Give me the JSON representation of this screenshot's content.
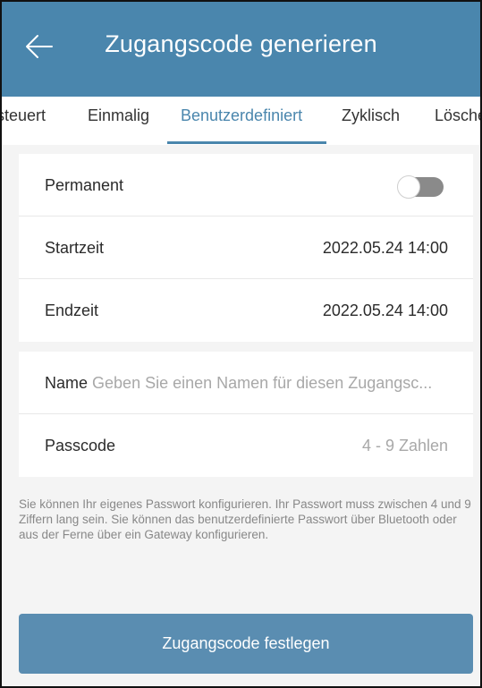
{
  "header": {
    "title": "Zugangscode generieren",
    "back_icon": "arrow-left-icon"
  },
  "tabs": [
    {
      "label": "steuert",
      "active": false
    },
    {
      "label": "Einmalig",
      "active": false
    },
    {
      "label": "Benutzerdefiniert",
      "active": true
    },
    {
      "label": "Zyklisch",
      "active": false
    },
    {
      "label": "Lösche",
      "active": false
    }
  ],
  "time_card": {
    "permanent_label": "Permanent",
    "permanent_on": false,
    "start_label": "Startzeit",
    "start_value": "2022.05.24 14:00",
    "end_label": "Endzeit",
    "end_value": "2022.05.24 14:00"
  },
  "code_card": {
    "name_label": "Name",
    "name_placeholder": "Geben Sie einen Namen für diesen Zugangsc...",
    "passcode_label": "Passcode",
    "passcode_placeholder": "4 - 9 Zahlen"
  },
  "hint_text": "Sie können Ihr eigenes Passwort konfigurieren. Ihr Passwort muss zwischen 4 und 9 Ziffern lang sein. Sie können das benutzerdefinierte Passwort über Bluetooth oder aus der Ferne über ein Gateway konfigurieren.",
  "submit_label": "Zugangscode festlegen",
  "colors": {
    "primary": "#4a86ad",
    "button": "#5a8db1",
    "background": "#f4f4f4"
  }
}
